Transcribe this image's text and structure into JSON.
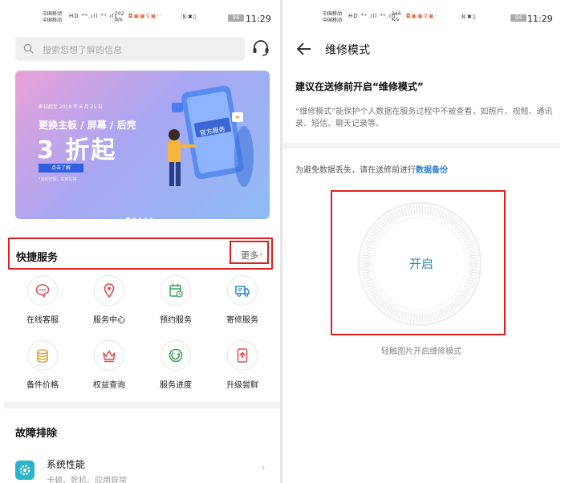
{
  "left": {
    "status": {
      "carrier1": "中国移动",
      "carrier2": "中国移动",
      "speed": "702",
      "speed_unit": "B/s",
      "battery": "94",
      "time": "11:29"
    },
    "search": {
      "placeholder": "搜索您想了解的信息"
    },
    "banner": {
      "date": "即日起至 2019 年 6 月 25 日",
      "line1": "更换主板 / 屏幕 / 后壳",
      "big": "3 折起",
      "button": "点击了解",
      "note": "*活动详情，先到先得",
      "sign": "官方服务"
    },
    "quick": {
      "title": "快捷服务",
      "more": "更多",
      "items": [
        {
          "label": "在线客服",
          "icon": "chat-icon",
          "color": "#e24a4a"
        },
        {
          "label": "服务中心",
          "icon": "location-icon",
          "color": "#e24a4a"
        },
        {
          "label": "预约服务",
          "icon": "calendar-icon",
          "color": "#3aa35a"
        },
        {
          "label": "寄修服务",
          "icon": "truck-icon",
          "color": "#2a8ad4"
        },
        {
          "label": "备件价格",
          "icon": "coins-icon",
          "color": "#d89a2a"
        },
        {
          "label": "权益查询",
          "icon": "crown-icon",
          "color": "#e24a4a"
        },
        {
          "label": "服务进度",
          "icon": "progress-icon",
          "color": "#3aa35a"
        },
        {
          "label": "升级尝鲜",
          "icon": "upgrade-icon",
          "color": "#e24a4a"
        }
      ]
    },
    "trouble": {
      "title": "故障排除",
      "item_title": "系统性能",
      "item_sub": "卡顿、死机、应用异常"
    }
  },
  "right": {
    "status": {
      "carrier1": "中国移动",
      "carrier2": "中国移动",
      "speed": "244",
      "speed_unit": "K/s",
      "battery": "94",
      "time": "11:29"
    },
    "title": "维修模式",
    "heading": "建议在送修前开启“维修模式”",
    "desc": "“维修模式”能保护个人数据在服务过程中不被查看，如照片、视频、通讯录、短信、聊天记录等。",
    "note_prefix": "为避免数据丢失，请在送修前进行",
    "note_link": "数据备份",
    "start": "开启",
    "caption": "轻触图片开启维修模式"
  }
}
